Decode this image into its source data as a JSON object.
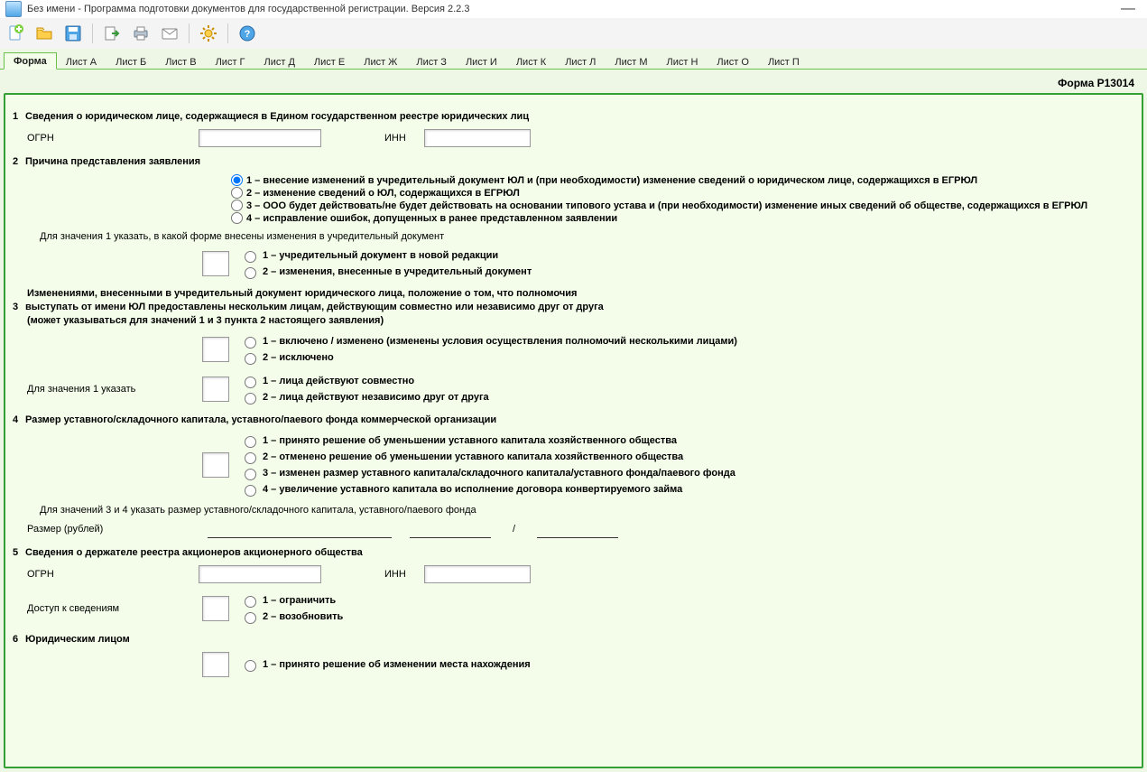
{
  "window": {
    "title": "Без имени - Программа подготовки документов для государственной регистрации. Версия 2.2.3"
  },
  "toolbar": {
    "new": "new-doc-icon",
    "open": "open-folder-icon",
    "save": "save-disk-icon",
    "export": "export-icon",
    "print": "print-icon",
    "mail": "mail-icon",
    "settings": "gear-icon",
    "help": "help-icon"
  },
  "tabs": [
    "Форма",
    "Лист А",
    "Лист Б",
    "Лист В",
    "Лист Г",
    "Лист Д",
    "Лист Е",
    "Лист Ж",
    "Лист З",
    "Лист И",
    "Лист К",
    "Лист Л",
    "Лист М",
    "Лист Н",
    "Лист О",
    "Лист П"
  ],
  "form_title": "Форма Р13014",
  "s1": {
    "title": "Сведения о юридическом лице, содержащиеся в Едином государственном реестре юридических лиц",
    "ogrn": "ОГРН",
    "inn": "ИНН"
  },
  "s2": {
    "title": "Причина представления заявления",
    "opt1": "1 – внесение изменений в учредительный документ ЮЛ и (при необходимости) изменение сведений о юридическом лице, содержащихся в ЕГРЮЛ",
    "opt2": "2 – изменение сведений о ЮЛ, содержащихся в ЕГРЮЛ",
    "opt3": "3 – ООО будет действовать/не будет действовать на основании типового устава и (при необходимости) изменение иных сведений об обществе, содержащихся в ЕГРЮЛ",
    "opt4": "4 – исправление ошибок, допущенных в ранее представленном заявлении",
    "hint1": "Для значения 1 указать, в какой форме внесены изменения в учредительный документ",
    "sub1a": "1 – учредительный документ в новой редакции",
    "sub1b": "2 – изменения, внесенные в учредительный документ"
  },
  "s3": {
    "para1": "Изменениями, внесенными в учредительный документ юридического лица, положение о том, что полномочия",
    "para2": "выступать от имени ЮЛ предоставлены нескольким лицам, действующим совместно или независимо друг от друга",
    "para3": "(может указываться для значений 1 и 3 пункта 2 настоящего заявления)",
    "o1": "1 – включено / изменено (изменены условия осуществления полномочий несколькими лицами)",
    "o2": "2 – исключено",
    "hint": "Для значения 1 указать",
    "s1": "1 – лица действуют совместно",
    "s2": "2 – лица действуют независимо друг от друга"
  },
  "s4": {
    "title": "Размер уставного/складочного капитала, уставного/паевого фонда коммерческой организации",
    "o1": "1 – принято решение об уменьшении уставного капитала хозяйственного общества",
    "o2": "2 – отменено решение об уменьшении уставного капитала хозяйственного общества",
    "o3": "3 – изменен размер уставного капитала/складочного капитала/уставного фонда/паевого фонда",
    "o4": "4 – увеличение уставного капитала во исполнение договора конвертируемого займа",
    "hint": "Для значений 3 и 4 указать размер уставного/складочного капитала, уставного/паевого фонда",
    "size_label": "Размер (рублей)",
    "slash": "/"
  },
  "s5": {
    "title": "Сведения о держателе реестра акционеров акционерного общества",
    "ogrn": "ОГРН",
    "inn": "ИНН",
    "access": "Доступ к сведениям",
    "o1": "1 – ограничить",
    "o2": "2 – возобновить"
  },
  "s6": {
    "title": "Юридическим лицом",
    "o1": "1 – принято решение об изменении места нахождения"
  }
}
